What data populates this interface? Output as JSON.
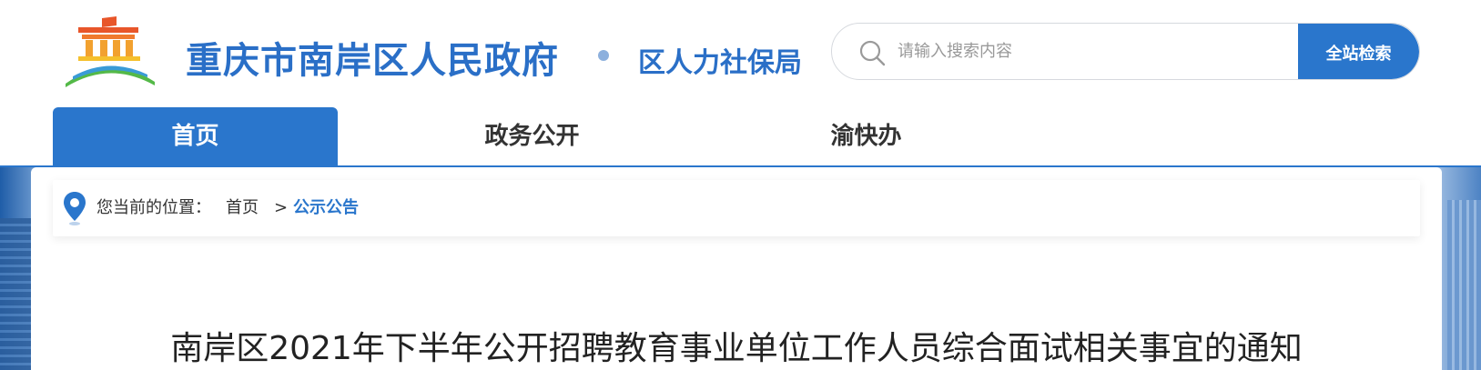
{
  "header": {
    "site_title": "重庆市南岸区人民政府",
    "department": "区人力社保局",
    "logo_icon": "government-logo-icon"
  },
  "search": {
    "placeholder": "请输入搜索内容",
    "value": "",
    "button_label": "全站检索",
    "icon": "search-icon"
  },
  "nav": {
    "items": [
      {
        "label": "首页",
        "active": true
      },
      {
        "label": "政务公开",
        "active": false
      },
      {
        "label": "渝快办",
        "active": false
      }
    ]
  },
  "breadcrumb": {
    "prefix": "您当前的位置：",
    "home": "首页",
    "separator": ">",
    "current": "公示公告",
    "icon": "location-pin-icon"
  },
  "article": {
    "title": "南岸区2021年下半年公开招聘教育事业单位工作人员综合面试相关事宜的通知"
  },
  "colors": {
    "accent": "#2a76cc",
    "title_blue": "#2a6fc7",
    "text": "#333333"
  }
}
